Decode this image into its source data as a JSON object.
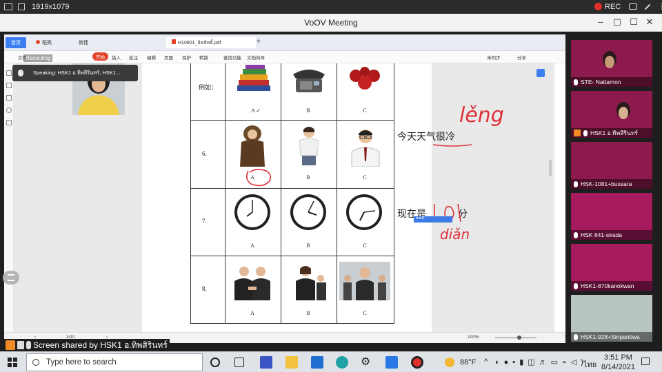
{
  "topbar": {
    "resolution": "1919x1079",
    "rec_label": "REC"
  },
  "window": {
    "title": "VoOV Meeting"
  },
  "wps": {
    "tabs": [
      "首页",
      "稻壳",
      "新建",
      "H10901_ลิขสิทธิ์.pdf"
    ],
    "ribbon": [
      "文件",
      "开始",
      "插入",
      "批注",
      "编辑",
      "页面",
      "保护",
      "转换",
      "查找功能",
      "文档向导",
      "未同步",
      "分享"
    ],
    "page_indicator": "3/10",
    "zoom": "100%"
  },
  "speaking": {
    "text": "Speaking: HSK1 อ.ทิพสิรินทร์; HSK1..."
  },
  "recording_tag": "Recording",
  "pdf": {
    "example_label": "例如：",
    "rows": [
      {
        "num": "6."
      },
      {
        "num": "7."
      },
      {
        "num": "8."
      }
    ],
    "options": [
      "A",
      "B",
      "C"
    ],
    "example_mark": "A ✓",
    "note1": "今天天气很冷",
    "note1_pinyin": "lěng",
    "note2": "现在是",
    "note2_suffix": "分",
    "note2_pinyin": "diǎn",
    "cursor_tag": "mini1"
  },
  "share": {
    "text": "Screen shared by HSK1 อ.ทิพสิรินทร์"
  },
  "participants": [
    {
      "name": "STE- Nattamon"
    },
    {
      "name": "HSK1 อ.ทิพสิรินทร์"
    },
    {
      "name": "HSK-1081+bussara"
    },
    {
      "name": "HSK 841-sirada"
    },
    {
      "name": "HSK1-870kanokwan"
    },
    {
      "name": "HSK1-928+Siripantiwa"
    }
  ],
  "taskbar": {
    "search_placeholder": "Type here to search",
    "weather": "88°F",
    "lang": "ไทย",
    "time": "3:51 PM",
    "date": "8/14/2021"
  }
}
